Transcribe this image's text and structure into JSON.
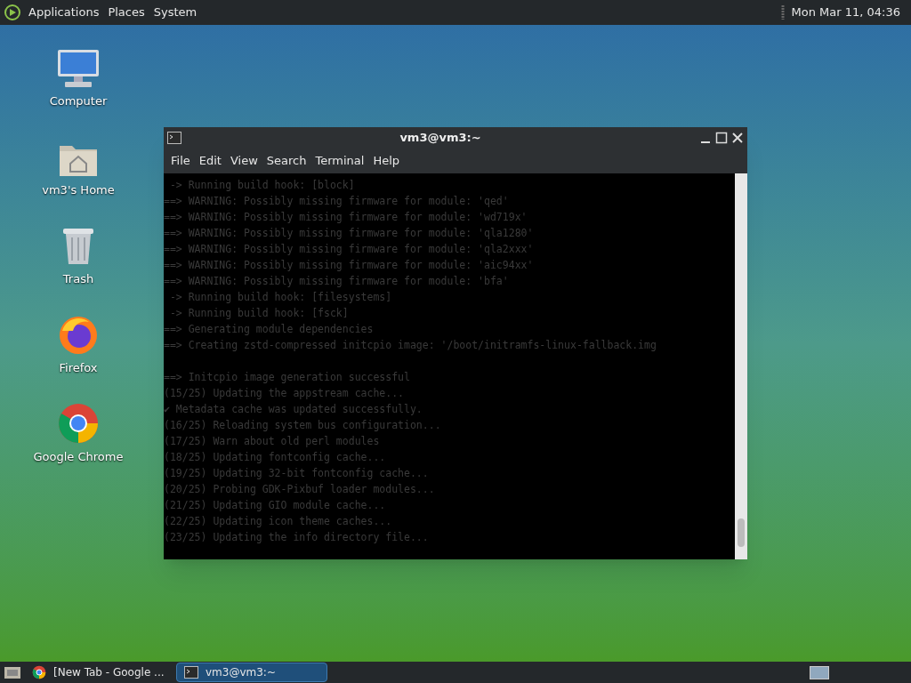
{
  "top_panel": {
    "menus": [
      "Applications",
      "Places",
      "System"
    ],
    "clock": "Mon Mar 11, 04:36"
  },
  "desktop_icons": [
    {
      "kind": "computer",
      "label": "Computer"
    },
    {
      "kind": "home",
      "label": "vm3's Home"
    },
    {
      "kind": "trash",
      "label": "Trash"
    },
    {
      "kind": "firefox",
      "label": "Firefox"
    },
    {
      "kind": "chrome",
      "label": "Google Chrome"
    }
  ],
  "terminal": {
    "title": "vm3@vm3:~",
    "menu": [
      "File",
      "Edit",
      "View",
      "Search",
      "Terminal",
      "Help"
    ],
    "lines": [
      " -> Running build hook: [block]",
      "==> WARNING: Possibly missing firmware for module: 'qed'",
      "==> WARNING: Possibly missing firmware for module: 'wd719x'",
      "==> WARNING: Possibly missing firmware for module: 'qla1280'",
      "==> WARNING: Possibly missing firmware for module: 'qla2xxx'",
      "==> WARNING: Possibly missing firmware for module: 'aic94xx'",
      "==> WARNING: Possibly missing firmware for module: 'bfa'",
      " -> Running build hook: [filesystems]",
      " -> Running build hook: [fsck]",
      "==> Generating module dependencies",
      "==> Creating zstd-compressed initcpio image: '/boot/initramfs-linux-fallback.img"
    ],
    "lines_after_blank": [
      "==> Initcpio image generation successful",
      "(15/25) Updating the appstream cache...",
      "✔ Metadata cache was updated successfully.",
      "(16/25) Reloading system bus configuration...",
      "(17/25) Warn about old perl modules",
      "(18/25) Updating fontconfig cache...",
      "(19/25) Updating 32-bit fontconfig cache...",
      "(20/25) Probing GDK-Pixbuf loader modules...",
      "(21/25) Updating GIO module cache...",
      "(22/25) Updating icon theme caches...",
      "(23/25) Updating the info directory file..."
    ]
  },
  "taskbar": {
    "tasks": [
      {
        "kind": "chrome",
        "label": "[New Tab - Google ...",
        "selected": false
      },
      {
        "kind": "terminal",
        "label": "vm3@vm3:~",
        "selected": true
      }
    ]
  }
}
